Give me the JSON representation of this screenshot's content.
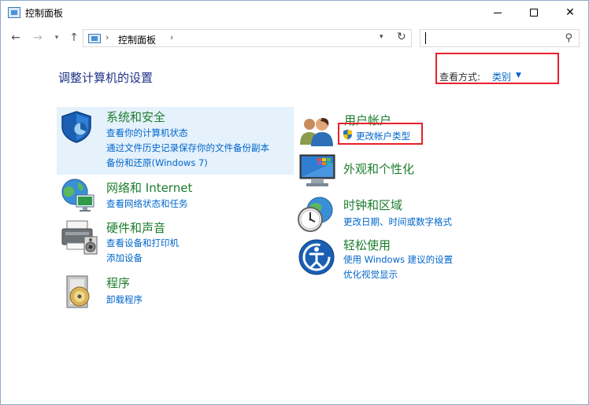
{
  "window": {
    "title": "控制面板"
  },
  "address": {
    "location": "控制面板",
    "search_placeholder": ""
  },
  "main": {
    "heading": "调整计算机的设置",
    "view_by_label": "查看方式:",
    "view_by_value": "类别",
    "categories": [
      {
        "title": "系统和安全",
        "links": [
          "查看你的计算机状态",
          "通过文件历史记录保存你的文件备份副本",
          "备份和还原(Windows 7)"
        ]
      },
      {
        "title": "网络和 Internet",
        "links": [
          "查看网络状态和任务"
        ]
      },
      {
        "title": "硬件和声音",
        "links": [
          "查看设备和打印机",
          "添加设备"
        ]
      },
      {
        "title": "程序",
        "links": [
          "卸载程序"
        ]
      },
      {
        "title": "用户帐户",
        "links": [
          "更改帐户类型"
        ]
      },
      {
        "title": "外观和个性化",
        "links": []
      },
      {
        "title": "时钟和区域",
        "links": [
          "更改日期、时间或数字格式"
        ]
      },
      {
        "title": "轻松使用",
        "links": [
          "使用 Windows 建议的设置",
          "优化视觉显示"
        ]
      }
    ]
  },
  "colors": {
    "category_title": "#1c7d2d",
    "link": "#0066cc",
    "heading": "#1e3287",
    "highlight_box": "#e8202a",
    "hover_background": "#e5f1fb"
  }
}
